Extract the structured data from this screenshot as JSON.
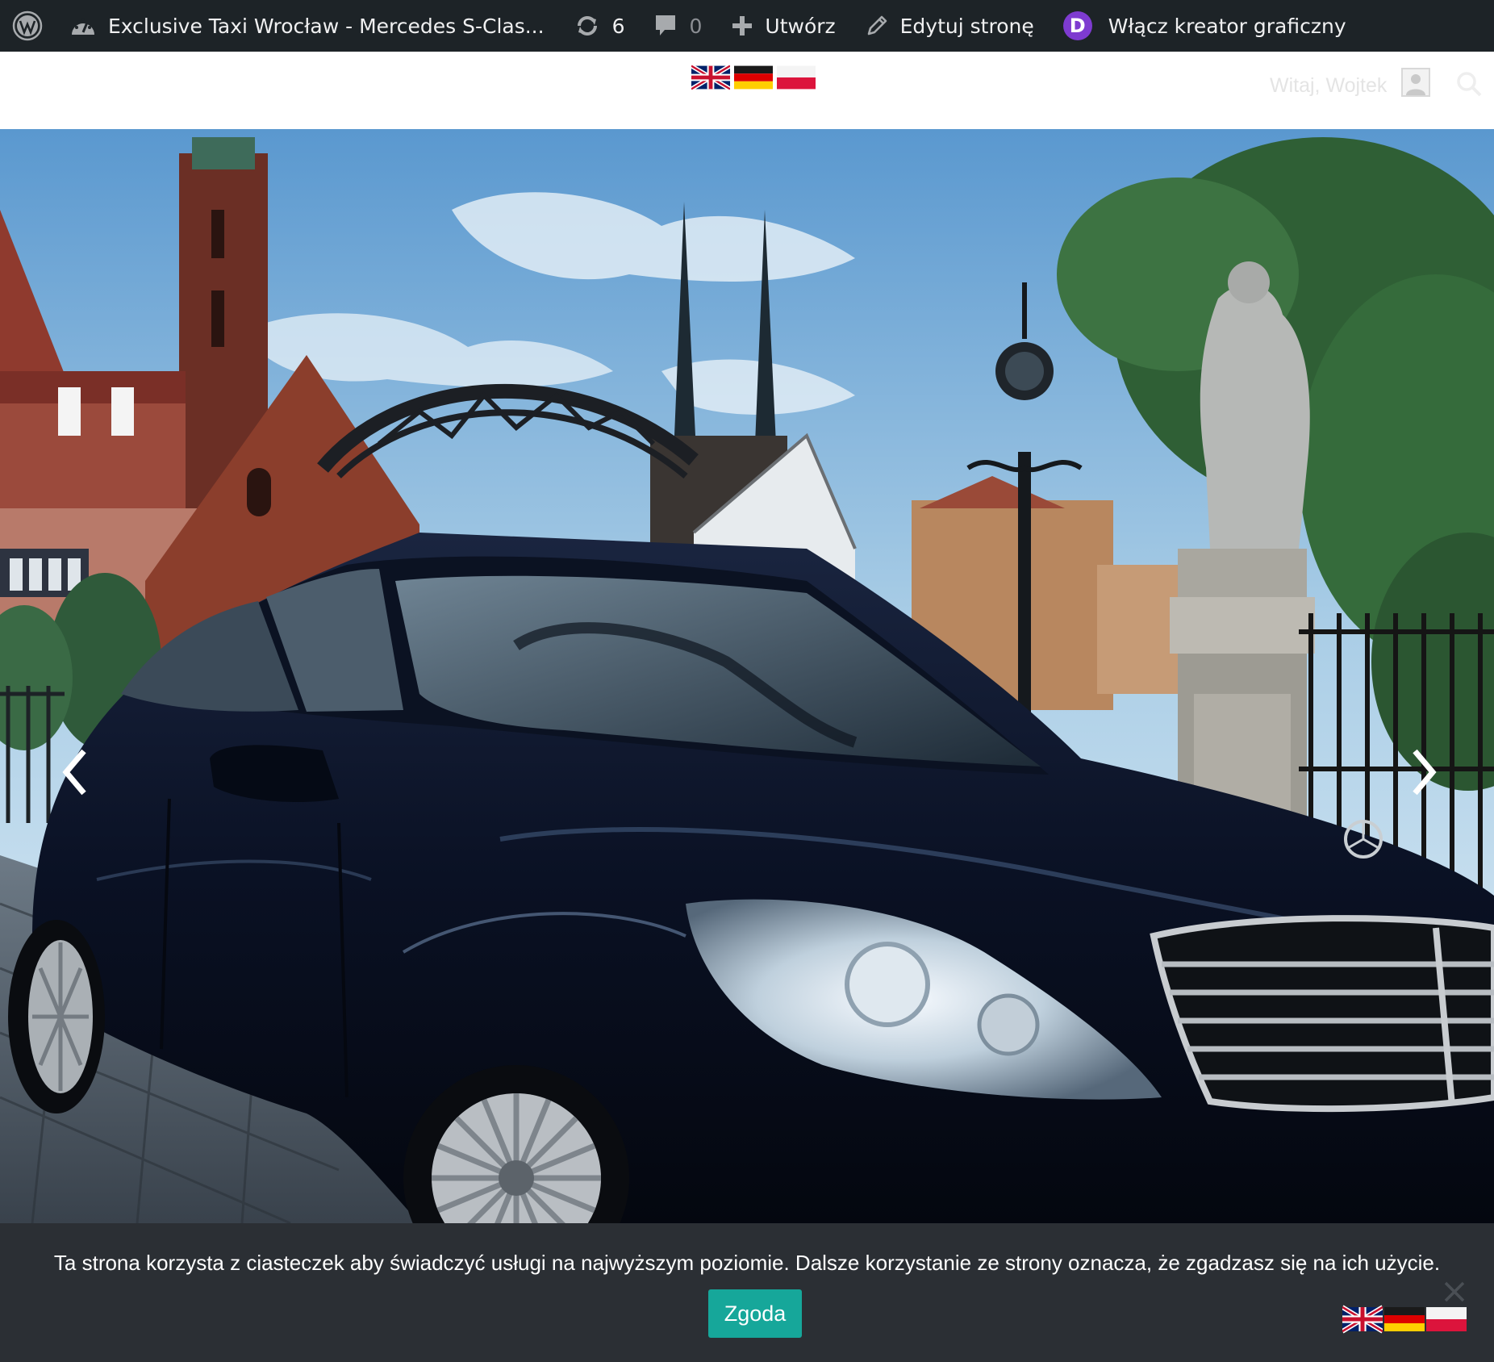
{
  "admin_bar": {
    "site_title": "Exclusive Taxi Wrocław - Mercedes S-Clas...",
    "updates_count": "6",
    "comments_count": "0",
    "new_label": "Utwórz",
    "edit_label": "Edytuj stronę",
    "divi_badge": "D",
    "divi_label": "Włącz kreator graficzny"
  },
  "header": {
    "languages": [
      "English",
      "Deutsch",
      "Polski"
    ],
    "greeting": "Witaj, Wojtek"
  },
  "cookie_bar": {
    "message": "Ta strona korzysta z ciasteczek aby świadczyć usługi na najwyższym poziomie. Dalsze korzystanie ze strony oznacza, że zgadzasz się na ich użycie.",
    "accept_label": "Zgoda"
  },
  "colors": {
    "admin_bar_bg": "#1d2327",
    "divi_purple": "#7e3bd0",
    "cookie_bg": "#2b2f34",
    "accept_button": "#16a79a"
  }
}
